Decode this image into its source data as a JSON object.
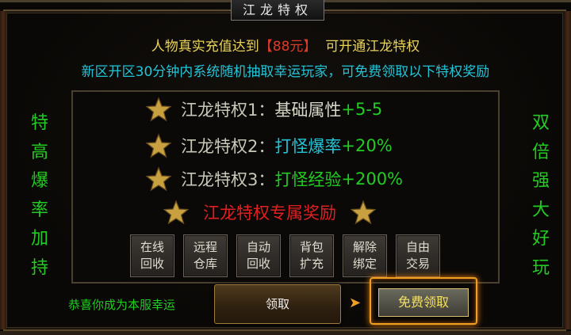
{
  "title": "江龙特权",
  "header": {
    "line1_prefix": "人物真实充值达到",
    "line1_amount": "【88元】",
    "line1_suffix": "可开通江龙特权",
    "line2": "新区开区30分钟内系统随机抽取幸运玩家，可免费领取以下特权奖励"
  },
  "side_left": [
    "特",
    "高",
    "爆",
    "率",
    "加",
    "持"
  ],
  "side_right": [
    "双",
    "倍",
    "强",
    "大",
    "好",
    "玩"
  ],
  "privileges": [
    {
      "name": "江龙特权1：",
      "value": "基础属性",
      "plus": "+5-5"
    },
    {
      "name": "江龙特权2：",
      "value": "打怪爆率",
      "plus": "+20%"
    },
    {
      "name": "江龙特权3：",
      "value": "打怪经验",
      "plus": "+200%"
    }
  ],
  "exclusive_label": "江龙特权专属奖励",
  "features": [
    {
      "line1": "在线",
      "line2": "回收"
    },
    {
      "line1": "远程",
      "line2": "仓库"
    },
    {
      "line1": "自动",
      "line2": "回收"
    },
    {
      "line1": "背包",
      "line2": "扩充"
    },
    {
      "line1": "解除",
      "line2": "绑定"
    },
    {
      "line1": "自由",
      "line2": "交易"
    }
  ],
  "congrats_text": "恭喜你成为本服幸运",
  "claim_button": "领取",
  "free_claim_button": "免费领取",
  "colors": {
    "yellow": "#e8d25a",
    "red": "#e03a2a",
    "cyan": "#24c4d8",
    "green": "#22cc22",
    "gold_border": "#f0a020"
  },
  "icons": {
    "star": "star-icon",
    "arrow": "double-chevron-right-icon"
  }
}
